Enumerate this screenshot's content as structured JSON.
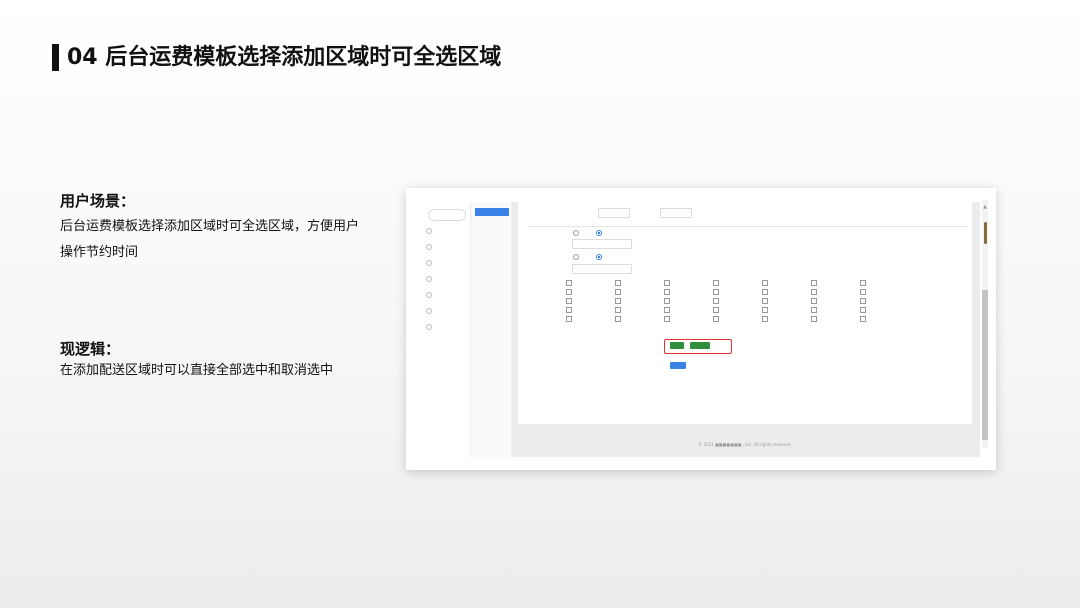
{
  "slide": {
    "title": "04 后台运费模板选择添加区域时可全选区域",
    "scenario_heading": "用户场景：",
    "scenario_body": "后台运费模板选择添加区域时可全选区域，方便用户操作节约时间",
    "logic_heading": "现逻辑：",
    "logic_body": "在添加配送区域时可以直接全部选中和取消选中"
  },
  "screenshot": {
    "search_placeholder": "",
    "sidebar1": [
      "",
      "",
      "",
      "",
      "",
      "",
      ""
    ],
    "sidebar1_active_index": 5,
    "sidebar2": [
      "",
      "",
      "",
      "",
      "",
      ""
    ],
    "sidebar2_active_index": 0,
    "sidebar2_footer": "",
    "form": {
      "row1_label": "",
      "row1_field_a_label": "",
      "row1_field_a_unit": "",
      "row1_field_b_label": "",
      "row1_field_b_unit": "",
      "free_shipping_label": "",
      "radio_yes": "",
      "radio_no": "",
      "amount_label": "",
      "enabled_label": "",
      "radio_enabled": "",
      "radio_disabled": "",
      "count_label": "",
      "regions_label": ""
    },
    "regions": [
      [
        "",
        "",
        "",
        "",
        "",
        "",
        ""
      ],
      [
        "",
        "",
        "",
        "",
        "",
        "",
        ""
      ],
      [
        "",
        "",
        "",
        "",
        "",
        "",
        ""
      ],
      [
        "",
        "",
        "",
        "",
        "",
        "",
        ""
      ],
      [
        "",
        "",
        "",
        "",
        "",
        "",
        ""
      ]
    ],
    "btn_select_all": "",
    "btn_deselect_all": "",
    "btn_submit": "",
    "footer": "© 2021 ■■■■■■■ , Inc. All rights reserved.",
    "colors": {
      "primary": "#3b82e6",
      "select_buttons": "#2f8f3a",
      "highlight": "#e03030"
    }
  }
}
